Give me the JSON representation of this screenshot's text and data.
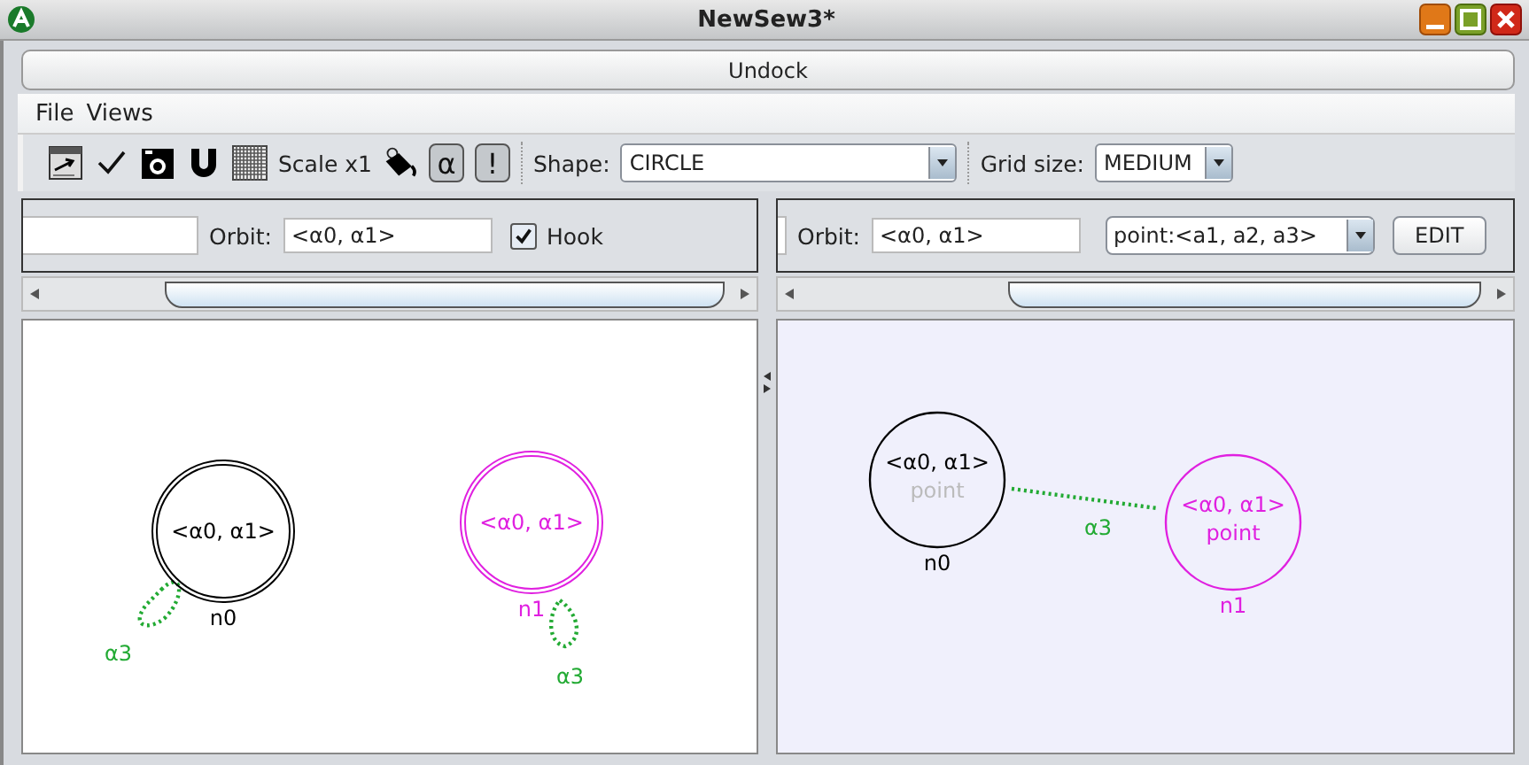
{
  "window": {
    "title": "NewSew3*"
  },
  "undock_button": "Undock",
  "menu": [
    {
      "label": "File"
    },
    {
      "label": "Views"
    }
  ],
  "toolbar": {
    "scale": "Scale x1",
    "toggles": [
      {
        "label": "α",
        "on": true
      },
      {
        "label": "!",
        "on": true
      }
    ],
    "shape": {
      "label": "Shape:",
      "value": "CIRCLE"
    },
    "grid_size": {
      "label": "Grid size:",
      "value": "MEDIUM"
    }
  },
  "panes": [
    {
      "kind": "topology",
      "orbit_label": "Orbit:",
      "orbit_value": "<α0, α1>",
      "hook": {
        "label": "Hook",
        "checked": true
      },
      "nodes": [
        {
          "orbit": "<α0, α1>",
          "name": "n0",
          "color": "#000000"
        },
        {
          "orbit": "<α0, α1>",
          "name": "n1",
          "color": "#e020e0"
        }
      ],
      "edges": [
        {
          "kind": "loop",
          "label": "α3",
          "color": "#22aa33"
        },
        {
          "kind": "loop",
          "label": "α3",
          "color": "#22aa33"
        }
      ]
    },
    {
      "kind": "embedding",
      "orbit_label": "Orbit:",
      "orbit_value": "<α0, α1>",
      "embedding": "point:<a1, a2, a3>",
      "edit_button": "EDIT",
      "nodes": [
        {
          "orbit": "<α0, α1>",
          "sublabel": "point",
          "sublabel_dimmed": true,
          "name": "n0",
          "color": "#000000"
        },
        {
          "orbit": "<α0, α1>",
          "sublabel": "point",
          "sublabel_dimmed": false,
          "name": "n1",
          "color": "#e020e0"
        }
      ],
      "edges": [
        {
          "kind": "link",
          "label": "α3",
          "color": "#22aa33"
        }
      ]
    }
  ]
}
